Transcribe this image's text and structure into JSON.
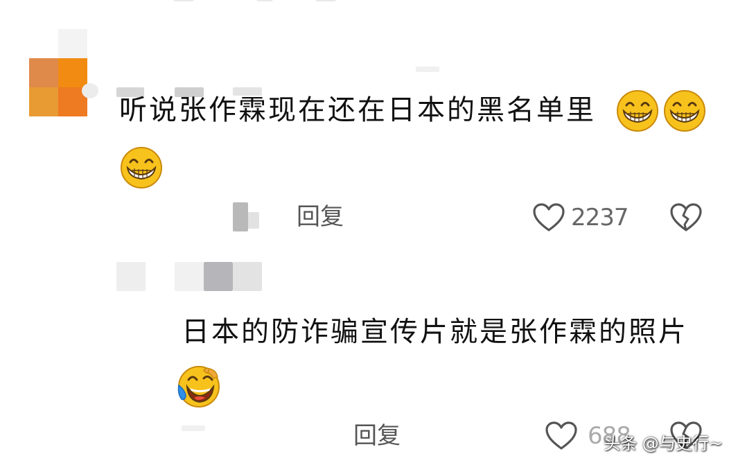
{
  "comments": [
    {
      "text": "听说张作霖现在还在日本的黑名单里",
      "emojis": [
        "grin-emoji",
        "grin-emoji",
        "grin-emoji"
      ],
      "reply_label": "回复",
      "like_count": "2237"
    },
    {
      "text": "日本的防诈骗宣传片就是张作霖的照片",
      "emojis": [
        "laugh-cry-emoji"
      ],
      "reply_label": "回复",
      "like_count": "688"
    }
  ],
  "watermark": "头条 @与史行~",
  "colors": {
    "avatar_orange": "#f08a1c",
    "emoji_yellow": "#f8c21d",
    "icon_gray": "#555555"
  }
}
